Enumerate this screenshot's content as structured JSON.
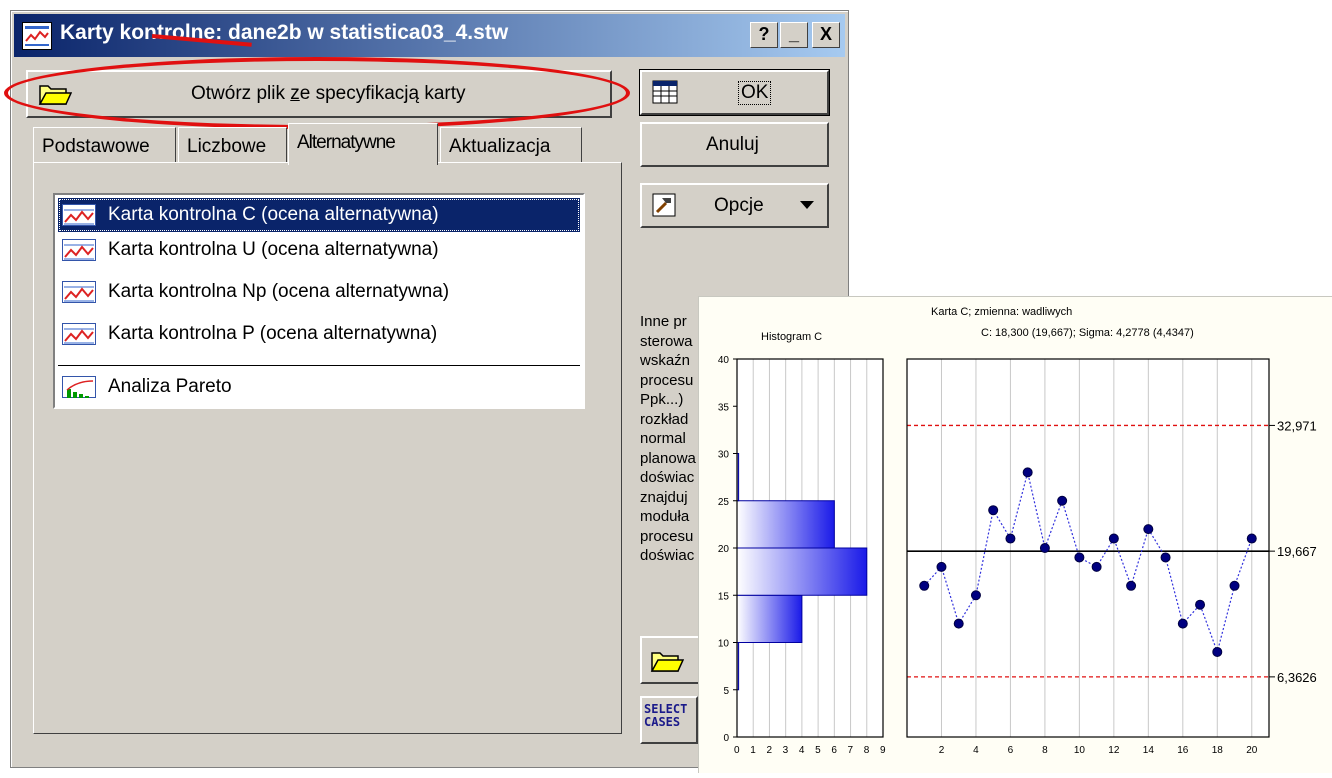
{
  "window": {
    "title": "Karty kontrolne: dane2b w statistica03_4.stw",
    "help_label": "?",
    "minimize_label": "_",
    "close_label": "X"
  },
  "buttons": {
    "open_spec_prefix": "Otwórz plik ",
    "open_spec_underlined": "z",
    "open_spec_suffix": "e specyfikacją karty",
    "ok": "OK",
    "cancel": "Anuluj",
    "options": "Opcje",
    "select_cases_line1": "SELECT",
    "select_cases_line2": "CASES"
  },
  "tabs": [
    {
      "label": "Podstawowe"
    },
    {
      "label": "Liczbowe"
    },
    {
      "label": "Alternatywne"
    },
    {
      "label": "Aktualizacja"
    }
  ],
  "chart_types": [
    {
      "label": "Karta kontrolna C (ocena alternatywna)",
      "selected": true
    },
    {
      "label": "Karta kontrolna U (ocena alternatywna)"
    },
    {
      "label": "Karta kontrolna Np (ocena alternatywna)"
    },
    {
      "label": "Karta kontrolna P (ocena alternatywna)"
    },
    {
      "label": "Analiza Pareto"
    }
  ],
  "description_lines": [
    "Inne pr",
    "sterowa",
    "wskaźn",
    "procesu",
    "Ppk...)",
    "rozkład",
    "normal",
    "planowa",
    "doświac",
    "znajduj",
    "moduła",
    "procesu",
    "doświac"
  ],
  "colors": {
    "title_gradient_start": "#0a246a",
    "title_gradient_end": "#a6caf0",
    "dialog_face": "#d4d0c8",
    "selection": "#0a246a",
    "highlight_marker": "#e01010",
    "series_point": "#000080",
    "control_limit": "#e01010"
  },
  "chart_data": [
    {
      "type": "bar",
      "orientation": "horizontal",
      "title": "Histogram C",
      "bins": [
        {
          "from": 5,
          "to": 10,
          "count": 0.1
        },
        {
          "from": 10,
          "to": 15,
          "count": 4
        },
        {
          "from": 15,
          "to": 20,
          "count": 8
        },
        {
          "from": 20,
          "to": 25,
          "count": 6
        },
        {
          "from": 25,
          "to": 30,
          "count": 0.1
        }
      ],
      "ylim": [
        0,
        40
      ],
      "y_ticks": [
        0,
        5,
        10,
        15,
        20,
        25,
        30,
        35,
        40
      ],
      "xlim": [
        0,
        9
      ],
      "x_ticks": [
        0,
        1,
        2,
        3,
        4,
        5,
        6,
        7,
        8,
        9
      ],
      "grid": true
    },
    {
      "type": "line",
      "title": "Karta C; zmienna:  wadliwych",
      "subtitle": "C: 18,300 (19,667); Sigma: 4,2778 (4,4347)",
      "x": [
        1,
        2,
        3,
        4,
        5,
        6,
        7,
        8,
        9,
        10,
        11,
        12,
        13,
        14,
        15,
        16,
        17,
        18,
        19,
        20
      ],
      "y": [
        16,
        18,
        12,
        15,
        24,
        21,
        28,
        20,
        25,
        19,
        18,
        21,
        16,
        22,
        19,
        12,
        14,
        9,
        16,
        21
      ],
      "x_ticks": [
        2,
        4,
        6,
        8,
        10,
        12,
        14,
        16,
        18,
        20
      ],
      "ylim": [
        0,
        40
      ],
      "center_line": 19.667,
      "ucl": 32.971,
      "lcl": 6.3626,
      "labels": {
        "ucl": "32,971",
        "center": "19,667",
        "lcl": "6,3626"
      },
      "grid": true
    }
  ]
}
